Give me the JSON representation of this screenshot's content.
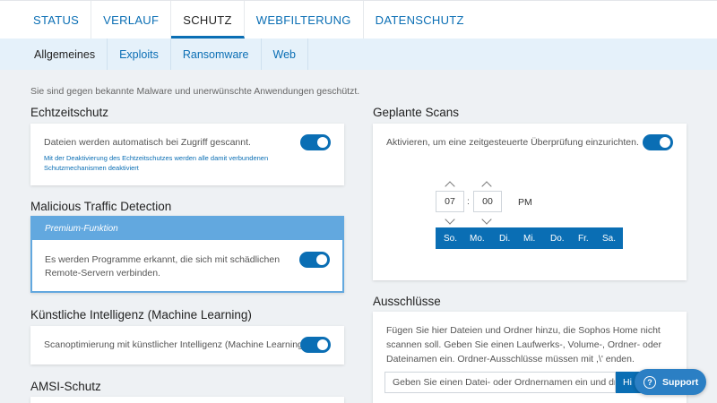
{
  "topnav": {
    "tabs": [
      {
        "label": "STATUS"
      },
      {
        "label": "VERLAUF"
      },
      {
        "label": "SCHUTZ"
      },
      {
        "label": "WEBFILTERUNG"
      },
      {
        "label": "DATENSCHUTZ"
      }
    ],
    "active_tab": "SCHUTZ"
  },
  "subnav": {
    "items": [
      {
        "label": "Allgemeines"
      },
      {
        "label": "Exploits"
      },
      {
        "label": "Ransomware"
      },
      {
        "label": "Web"
      }
    ],
    "active_item": "Allgemeines"
  },
  "intro": "Sie sind gegen bekannte Malware und unerwünschte Anwendungen geschützt.",
  "realtime": {
    "title": "Echtzeitschutz",
    "text": "Dateien werden automatisch bei Zugriff gescannt.",
    "note_line1": "Mit der Deaktivierung des Echtzeitschutzes werden alle damit verbundenen",
    "note_line2": "Schutzmechanismen deaktiviert",
    "enabled": true
  },
  "traffic": {
    "title": "Malicious Traffic Detection",
    "premium_label": "Premium-Funktion",
    "text_line1": "Es werden Programme erkannt, die sich mit schädlichen",
    "text_line2": "Remote-Servern verbinden.",
    "enabled": true
  },
  "ai": {
    "title": "Künstliche Intelligenz (Machine Learning)",
    "text": "Scanoptimierung mit künstlicher Intelligenz (Machine Learning).",
    "enabled": true
  },
  "amsi": {
    "title": "AMSI-Schutz"
  },
  "scheduled": {
    "title": "Geplante Scans",
    "text": "Aktivieren, um eine zeitgesteuerte Überprüfung einzurichten.",
    "enabled": true,
    "hour": "07",
    "separator": ":",
    "minute": "00",
    "ampm": "PM",
    "days": [
      "So.",
      "Mo.",
      "Di.",
      "Mi.",
      "Do.",
      "Fr.",
      "Sa."
    ]
  },
  "exclusions": {
    "title": "Ausschlüsse",
    "text_line1": "Fügen Sie hier Dateien und Ordner hinzu, die Sophos Home nicht",
    "text_line2": "scannen soll. Geben Sie einen Laufwerks-, Volume-, Ordner- oder",
    "text_line3": "Dateinamen ein. Ordner-Ausschlüsse müssen mit ,\\' enden.",
    "input_value": "Geben Sie einen Datei- oder Ordnernamen ein und drücl",
    "add_button": "Hi"
  },
  "support": {
    "label": "Support",
    "icon_glyph": "?"
  },
  "colors": {
    "accent": "#0a6eb4",
    "premium": "#62a8df",
    "background": "#eef1f4"
  }
}
